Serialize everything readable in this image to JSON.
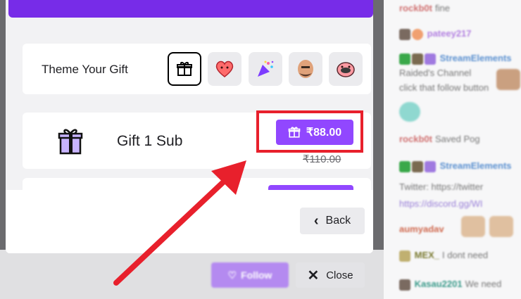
{
  "modal": {
    "theme": {
      "label": "Theme Your Gift",
      "options": [
        {
          "icon": "gift-icon",
          "selected": true
        },
        {
          "icon": "heart-emote-icon",
          "selected": false
        },
        {
          "icon": "party-popper-icon",
          "selected": false
        },
        {
          "icon": "face-emote-icon",
          "selected": false
        },
        {
          "icon": "blob-emote-icon",
          "selected": false
        }
      ]
    },
    "gift_sub": {
      "title": "Gift 1 Sub",
      "price": "₹88.00",
      "original_price": "₹110.00"
    },
    "back_label": "Back"
  },
  "bottom_bar": {
    "follow_label": "Follow",
    "close_label": "Close"
  },
  "chat": {
    "lines": [
      {
        "user": "rockb0t",
        "text": "fine"
      },
      {
        "user": "pateey217",
        "text": ""
      },
      {
        "user": "StreamElements",
        "text": ""
      },
      {
        "user": "",
        "text": "Raided's Channel"
      },
      {
        "user": "",
        "text": "click that follow button"
      },
      {
        "user": "rockb0t",
        "text": "Saved Pog"
      },
      {
        "user": "StreamElements",
        "text": ""
      },
      {
        "user": "",
        "text": "Twitter: https://twitter"
      },
      {
        "user": "",
        "text": "https://discord.gg/WI"
      },
      {
        "user": "aumyadav",
        "text": ""
      },
      {
        "user": "MEX_",
        "text": "I dont need"
      },
      {
        "user": "Kasau2201",
        "text": "We need"
      }
    ]
  },
  "colors": {
    "brand_purple": "#9147ff",
    "highlight_red": "#e8202c"
  }
}
